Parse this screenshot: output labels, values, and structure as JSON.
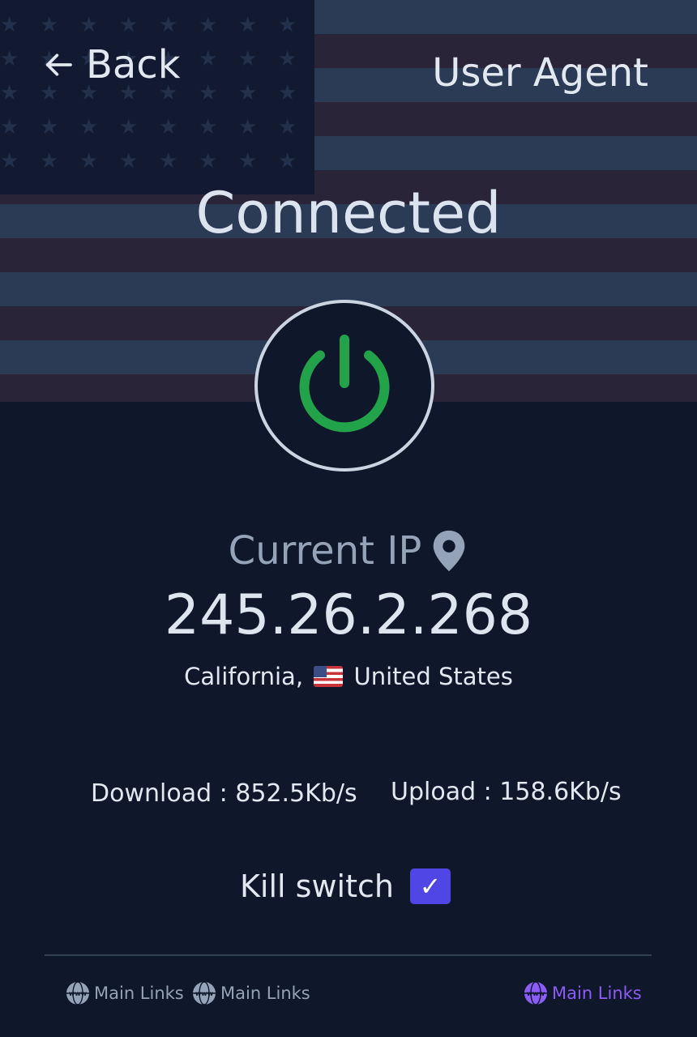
{
  "header": {
    "back_label": "Back",
    "title": "User Agent"
  },
  "connection": {
    "status": "Connected",
    "power_icon": "power-icon",
    "power_color": "#22a34a"
  },
  "ip": {
    "label": "Current IP",
    "value": "245.26.2.268",
    "region": "California,",
    "country": "United States"
  },
  "stats": {
    "download": "Download : 852.5Kb/s",
    "upload": "Upload : 158.6Kb/s"
  },
  "kill_switch": {
    "label": "Kill switch",
    "checked": true,
    "check_glyph": "✓"
  },
  "footer": {
    "links": [
      {
        "label": "Main Links",
        "icon": "globe-icon",
        "active": false
      },
      {
        "label": "Main Links",
        "icon": "globe-icon",
        "active": false
      },
      {
        "label": "Main Links",
        "icon": "globe-icon",
        "active": true
      }
    ]
  },
  "colors": {
    "background": "#0f172a",
    "accent": "#4f46e5",
    "active_link": "#8b5cf6"
  }
}
